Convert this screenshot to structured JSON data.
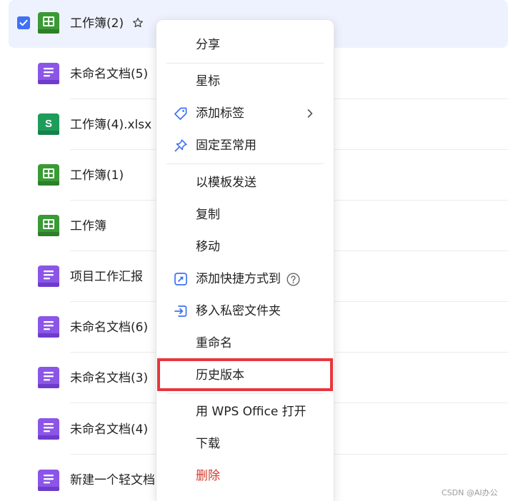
{
  "files": [
    {
      "name": "工作簿(2)",
      "type": "sheet",
      "selected": true,
      "starred_icon": "star-outline-icon"
    },
    {
      "name": "未命名文档(5)",
      "type": "doc"
    },
    {
      "name": "工作簿(4).xlsx",
      "type": "xlsx",
      "icon_letter": "S"
    },
    {
      "name": "工作簿(1)",
      "type": "sheet"
    },
    {
      "name": "工作簿",
      "type": "sheet"
    },
    {
      "name": "项目工作汇报",
      "type": "doc"
    },
    {
      "name": "未命名文档(6)",
      "type": "doc"
    },
    {
      "name": "未命名文档(3)",
      "type": "doc"
    },
    {
      "name": "未命名文档(4)",
      "type": "doc"
    },
    {
      "name": "新建一个轻文档",
      "type": "doc"
    }
  ],
  "menu": {
    "items": [
      {
        "label": "分享"
      },
      {
        "label": "星标"
      },
      {
        "label": "添加标签",
        "icon": "tag-icon",
        "submenu": true
      },
      {
        "label": "固定至常用",
        "icon": "pin-icon"
      },
      {
        "label": "以模板发送"
      },
      {
        "label": "复制"
      },
      {
        "label": "移动"
      },
      {
        "label": "添加快捷方式到",
        "icon": "shortcut-icon",
        "help": true
      },
      {
        "label": "移入私密文件夹",
        "icon": "move-in-icon"
      },
      {
        "label": "重命名"
      },
      {
        "label": "历史版本",
        "highlighted": true
      },
      {
        "label": "用 WPS Office 打开"
      },
      {
        "label": "下载"
      },
      {
        "label": "删除",
        "danger": true
      }
    ]
  },
  "watermark": "CSDN @AI办公",
  "colors": {
    "accent": "#3f71f4",
    "selected_row": "#eef2fe",
    "sheet_green": "#3a9a35",
    "xlsx_green": "#1e9c5a",
    "doc_purple": "#8b55e8",
    "danger": "#d33b2f",
    "highlight_border": "#e8363c"
  }
}
